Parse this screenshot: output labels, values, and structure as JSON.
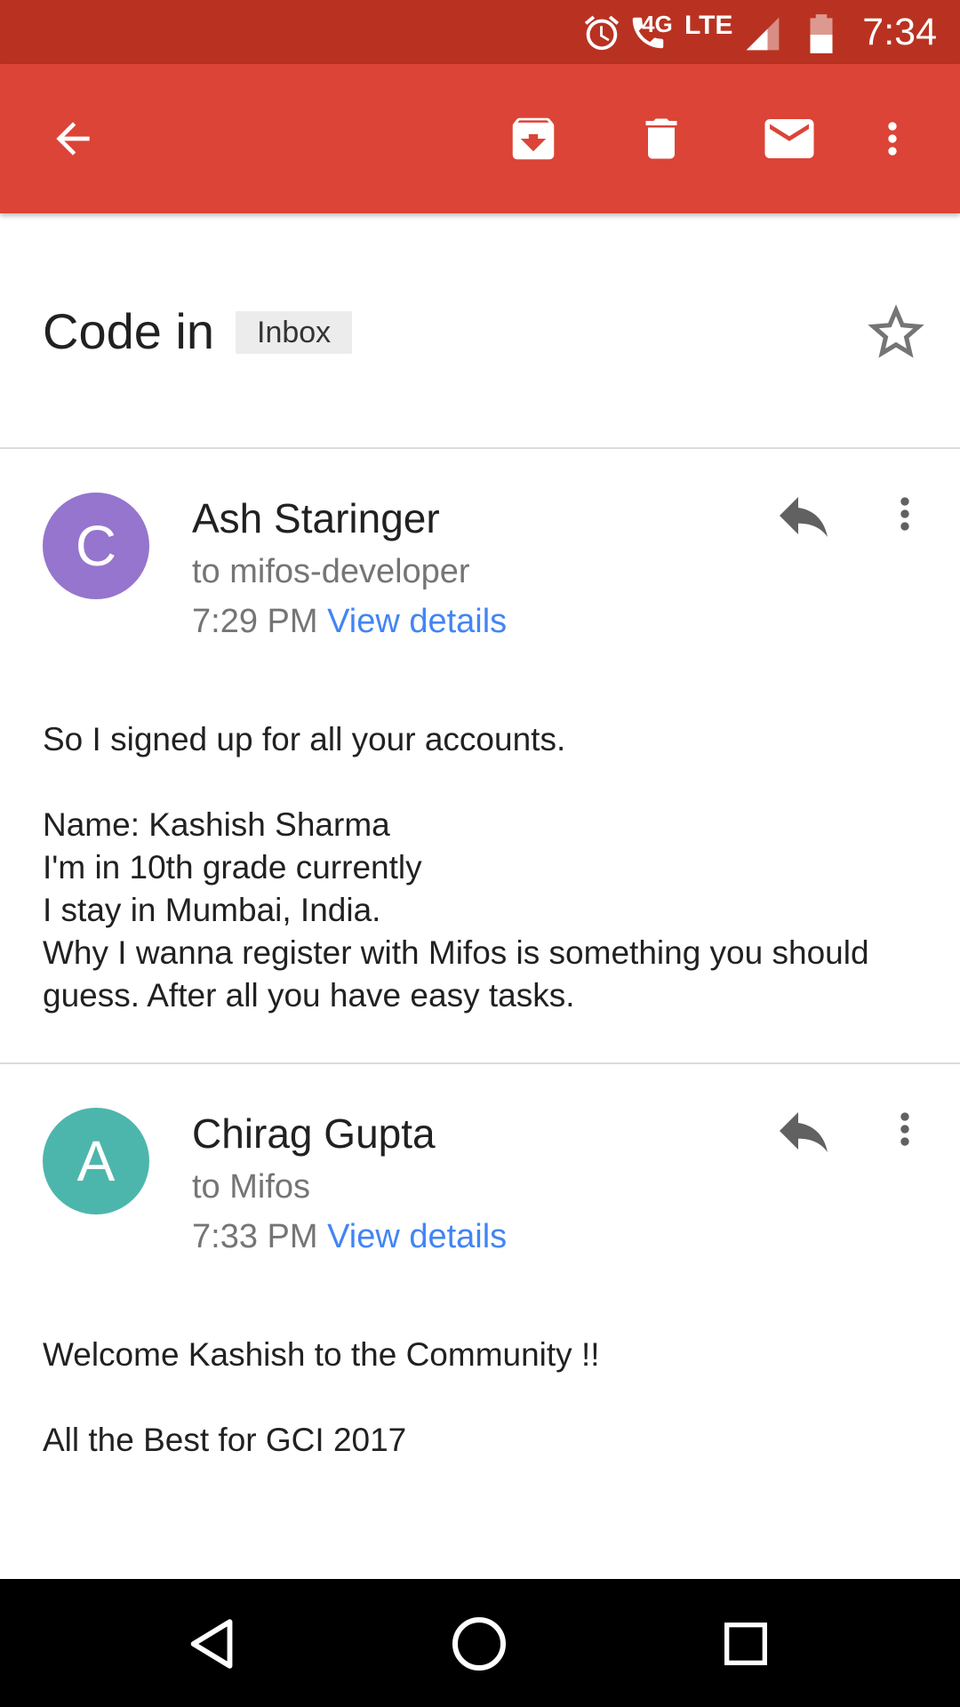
{
  "status_bar": {
    "time": "7:34",
    "network": "LTE",
    "network_gen": "4G",
    "icons": [
      "alarm-icon",
      "wifi-call-icon",
      "signal-icon",
      "battery-icon"
    ]
  },
  "toolbar": {
    "icons": [
      "back-arrow-icon",
      "archive-icon",
      "delete-icon",
      "mark-unread-icon",
      "more-vert-icon"
    ],
    "color": "#db4437"
  },
  "thread": {
    "subject": "Code in",
    "label": "Inbox"
  },
  "messages": [
    {
      "avatar_letter": "C",
      "avatar_color": "#9575cd",
      "sender": "Ash Staringer",
      "recipient": "to mifos-developer",
      "time": "7:29 PM",
      "details_link": "View details",
      "body": "So I signed up for all your accounts.\n\nName: Kashish Sharma\nI'm in 10th grade currently\nI stay in Mumbai, India.\nWhy I wanna register with Mifos is something you should guess. After all you have easy tasks."
    },
    {
      "avatar_letter": "A",
      "avatar_color": "#4db6ac",
      "sender": "Chirag Gupta",
      "recipient": "to Mifos",
      "time": "7:33 PM",
      "details_link": "View details",
      "body": "Welcome Kashish to the Community !!\n\nAll the Best for GCI 2017"
    }
  ],
  "nav_bar": {
    "icons": [
      "back-triangle-icon",
      "home-circle-icon",
      "recents-square-icon"
    ]
  },
  "colors": {
    "status_bar": "#b93221",
    "link": "#4285f4"
  }
}
